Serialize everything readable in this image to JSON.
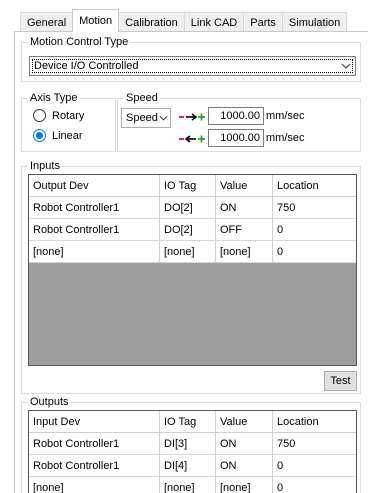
{
  "tabs": [
    {
      "label": "General"
    },
    {
      "label": "Motion"
    },
    {
      "label": "Calibration"
    },
    {
      "label": "Link CAD"
    },
    {
      "label": "Parts"
    },
    {
      "label": "Simulation"
    }
  ],
  "active_tab": "Motion",
  "motion_control": {
    "title": "Motion Control Type",
    "selected": "Device I/O Controlled"
  },
  "axis_type": {
    "title": "Axis Type",
    "options": [
      {
        "label": "Rotary",
        "checked": false
      },
      {
        "label": "Linear",
        "checked": true
      }
    ]
  },
  "speed": {
    "title": "Speed",
    "mode": "Speed",
    "forward_value": "1000.00",
    "reverse_value": "1000.00",
    "unit": "mm/sec",
    "forward_arrow": "-→+",
    "reverse_arrow": "-←+"
  },
  "inputs": {
    "title": "Inputs",
    "columns": [
      "Output Dev",
      "IO Tag",
      "Value",
      "Location"
    ],
    "rows": [
      [
        "Robot Controller1",
        "DO[2]",
        "ON",
        "750"
      ],
      [
        "Robot Controller1",
        "DO[2]",
        "OFF",
        "0"
      ],
      [
        "[none]",
        "[none]",
        "[none]",
        "0"
      ]
    ],
    "test_label": "Test"
  },
  "outputs": {
    "title": "Outputs",
    "columns": [
      "Input Dev",
      "IO Tag",
      "Value",
      "Location"
    ],
    "rows": [
      [
        "Robot Controller1",
        "DI[3]",
        "ON",
        "750"
      ],
      [
        "Robot Controller1",
        "DI[4]",
        "ON",
        "0"
      ],
      [
        "[none]",
        "[none]",
        "[none]",
        "0"
      ]
    ]
  },
  "icons": {
    "dropdown": "chevron-down-icon"
  }
}
